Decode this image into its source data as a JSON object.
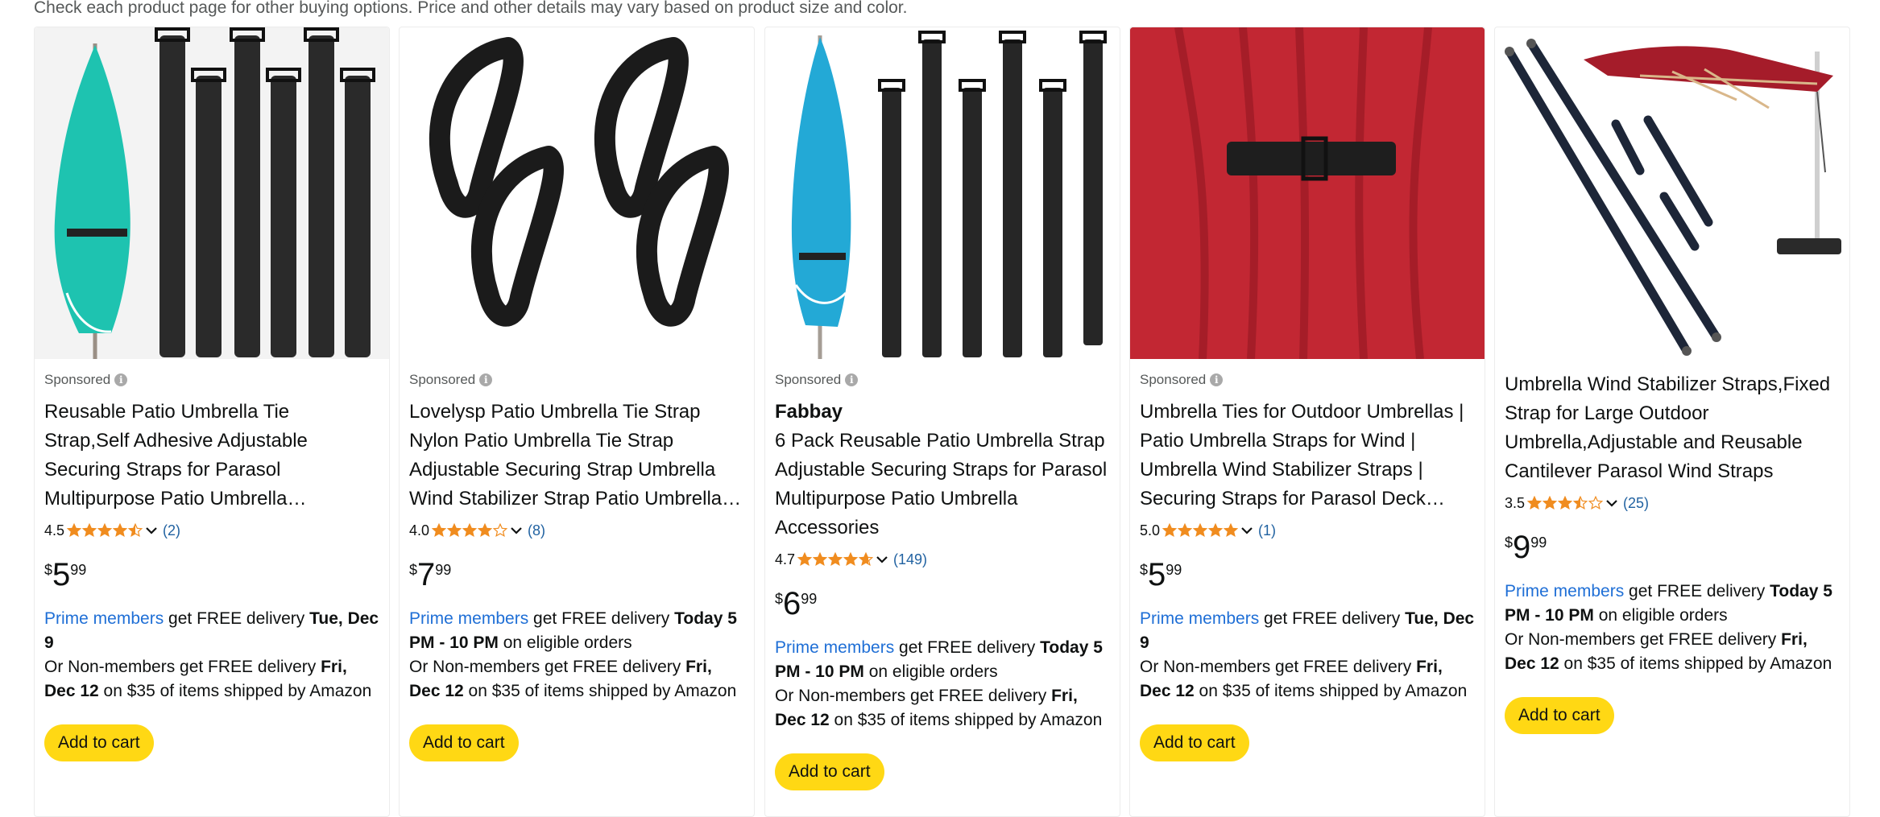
{
  "notice": "Check each product page for other buying options. Price and other details may vary based on product size and color.",
  "colors": {
    "star": "#f08c1f",
    "link": "#2162a1",
    "prime": "#1f6fd6",
    "cart": "#ffd814"
  },
  "sponsored_label": "Sponsored",
  "prime_label": "Prime members",
  "products": [
    {
      "sponsored": true,
      "brand": "",
      "title": "Reusable Patio Umbrella Tie Strap,Self Adhesive Adjustable Securing Straps for Parasol Multipurpose Patio Umbrella Accessories",
      "rating": "4.5",
      "stars": 4.5,
      "count": "(2)",
      "price_symbol": "$",
      "price_whole": "5",
      "price_fraction": "99",
      "delivery_prime": "get FREE delivery ",
      "delivery_prime_bold": "Tue, Dec 9",
      "delivery_prime_tail": "",
      "delivery_nonmember": "Or Non-members get FREE delivery ",
      "delivery_nonmember_bold": "Fri, Dec 12",
      "delivery_nonmember_tail": " on $35 of items shipped by Amazon",
      "button": "Add to cart",
      "image_icon": "teal-umbrella-with-straps"
    },
    {
      "sponsored": true,
      "brand": "",
      "title": "Lovelysp Patio Umbrella Tie Strap Nylon Patio Umbrella Tie Strap Adjustable Securing Strap Umbrella Wind Stabilizer Strap Patio Umbrella Holder",
      "rating": "4.0",
      "stars": 4.0,
      "count": "(8)",
      "price_symbol": "$",
      "price_whole": "7",
      "price_fraction": "99",
      "delivery_prime": "get FREE delivery ",
      "delivery_prime_bold": "Today 5 PM - 10 PM",
      "delivery_prime_tail": " on eligible orders",
      "delivery_nonmember": "Or Non-members get FREE delivery ",
      "delivery_nonmember_bold": "Fri, Dec 12",
      "delivery_nonmember_tail": " on $35 of items shipped by Amazon",
      "button": "Add to cart",
      "image_icon": "black-loop-straps"
    },
    {
      "sponsored": true,
      "brand": "Fabbay",
      "title": "6 Pack Reusable Patio Umbrella Strap Adjustable Securing Straps for Parasol Multipurpose Patio Umbrella Accessories",
      "rating": "4.7",
      "stars": 4.7,
      "count": "(149)",
      "price_symbol": "$",
      "price_whole": "6",
      "price_fraction": "99",
      "delivery_prime": "get FREE delivery ",
      "delivery_prime_bold": "Today 5 PM - 10 PM",
      "delivery_prime_tail": " on eligible orders",
      "delivery_nonmember": "Or Non-members get FREE delivery ",
      "delivery_nonmember_bold": "Fri, Dec 12",
      "delivery_nonmember_tail": " on $35 of items shipped by Amazon",
      "button": "Add to cart",
      "image_icon": "blue-umbrella-with-straps"
    },
    {
      "sponsored": true,
      "brand": "",
      "title": "Umbrella Ties for Outdoor Umbrellas | Patio Umbrella Straps for Wind | Umbrella Wind Stabilizer Straps | Securing Straps for Parasol Deck Umbrella",
      "rating": "5.0",
      "stars": 5.0,
      "count": "(1)",
      "price_symbol": "$",
      "price_whole": "5",
      "price_fraction": "99",
      "delivery_prime": "get FREE delivery ",
      "delivery_prime_bold": "Tue, Dec 9",
      "delivery_prime_tail": "",
      "delivery_nonmember": "Or Non-members get FREE delivery ",
      "delivery_nonmember_bold": "Fri, Dec 12",
      "delivery_nonmember_tail": " on $35 of items shipped by Amazon",
      "button": "Add to cart",
      "image_icon": "red-umbrella-tied"
    },
    {
      "sponsored": false,
      "brand": "",
      "title": "Umbrella Wind Stabilizer Straps,Fixed Strap for Large Outdoor Umbrella,Adjustable and Reusable Cantilever Parasol Wind Straps",
      "rating": "3.5",
      "stars": 3.5,
      "count": "(25)",
      "price_symbol": "$",
      "price_whole": "9",
      "price_fraction": "99",
      "delivery_prime": "get FREE delivery ",
      "delivery_prime_bold": "Today 5 PM - 10 PM",
      "delivery_prime_tail": " on eligible orders",
      "delivery_nonmember": "Or Non-members get FREE delivery ",
      "delivery_nonmember_bold": "Fri, Dec 12",
      "delivery_nonmember_tail": " on $35 of items shipped by Amazon",
      "button": "Add to cart",
      "image_icon": "cantilever-umbrella-straps"
    }
  ]
}
